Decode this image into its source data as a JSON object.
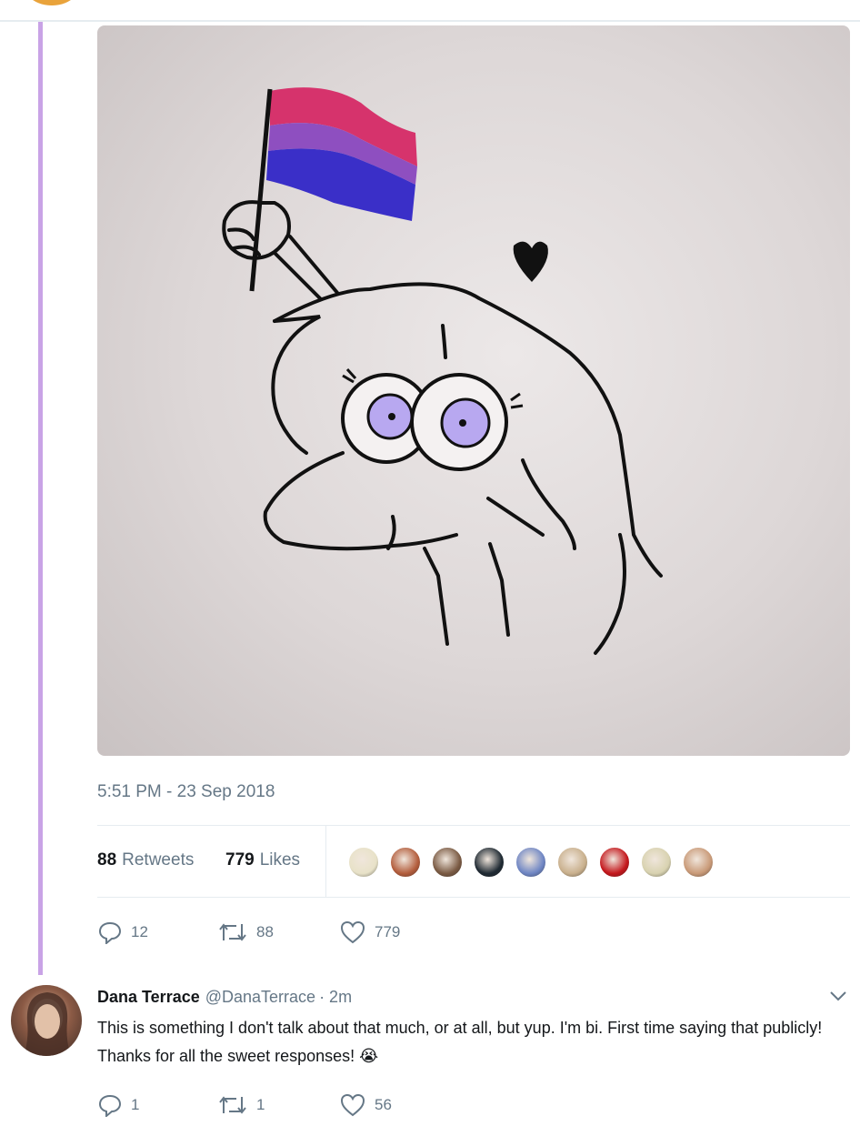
{
  "tweet": {
    "timestamp": "5:51 PM - 23 Sep 2018",
    "retweets_count": "88",
    "retweets_label": "Retweets",
    "likes_count": "779",
    "likes_label": "Likes",
    "actions": {
      "replies": "12",
      "retweets": "88",
      "likes": "779"
    },
    "liker_avatar_colors": [
      "#e8e2c8",
      "#b35d3c",
      "#7a5a43",
      "#1f2a33",
      "#6f86c4",
      "#c9b08d",
      "#c4171c",
      "#d8d2b0",
      "#c99a78"
    ]
  },
  "reply": {
    "name": "Dana Terrace",
    "handle": "@DanaTerrace",
    "time": "· 2m",
    "text": "This is something I don't talk about that much, or at all, but yup. I'm bi. First time saying that publicly! Thanks for all the sweet responses! 😭",
    "actions": {
      "replies": "1",
      "retweets": "1",
      "likes": "56"
    }
  },
  "colors": {
    "thread_line": "#c9a3e6",
    "flag_pink": "#d6336c",
    "flag_purple": "#8e4fc0",
    "flag_blue": "#3a2fc8",
    "eye_iris": "#b8a8f0"
  }
}
